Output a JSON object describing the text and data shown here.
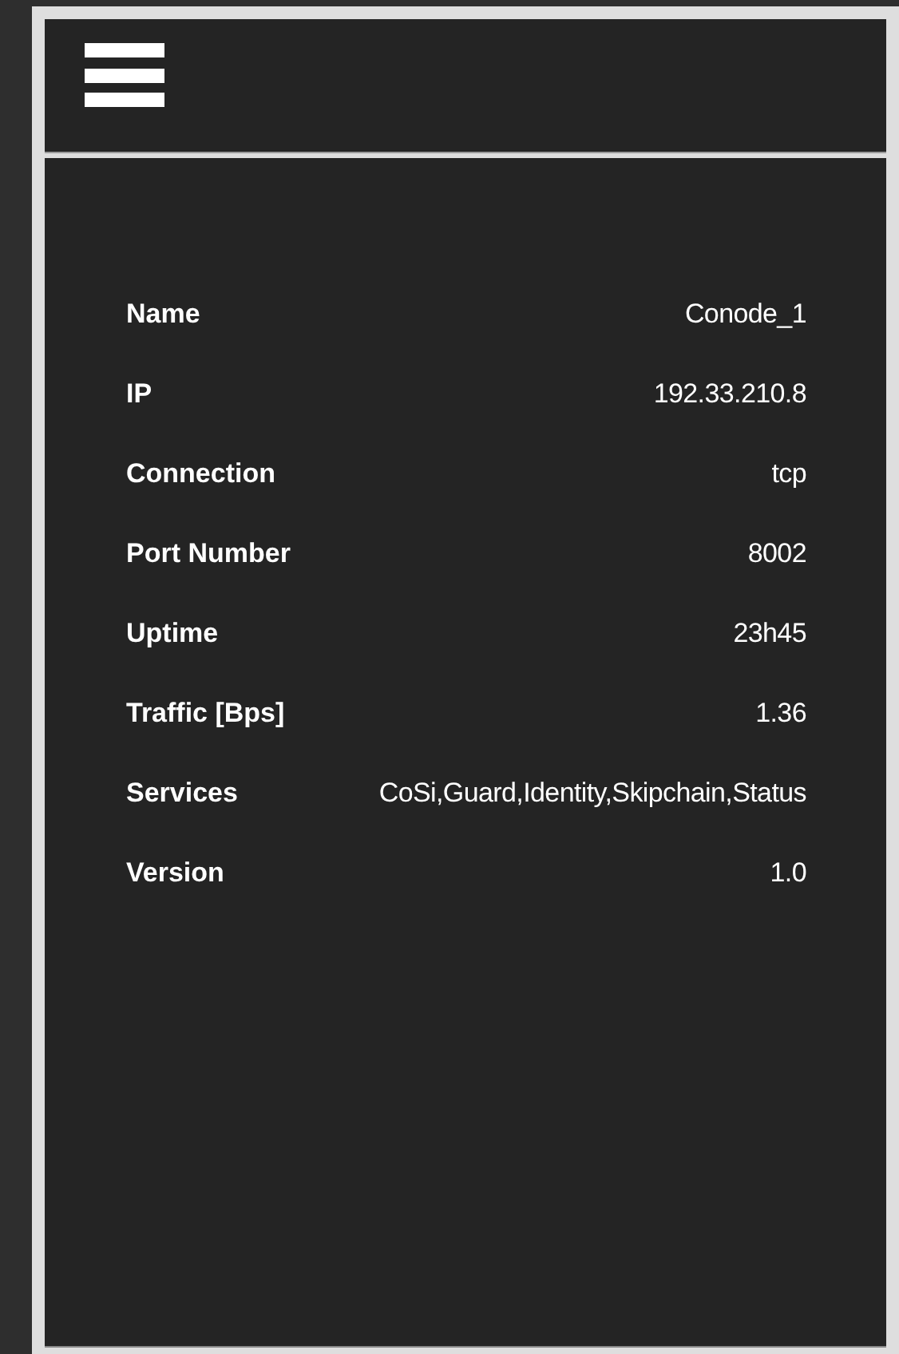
{
  "details": [
    {
      "label": "Name",
      "value": "Conode_1"
    },
    {
      "label": "IP",
      "value": "192.33.210.8"
    },
    {
      "label": "Connection",
      "value": "tcp"
    },
    {
      "label": "Port Number",
      "value": "8002"
    },
    {
      "label": "Uptime",
      "value": "23h45"
    },
    {
      "label": "Traffic [Bps]",
      "value": "1.36"
    },
    {
      "label": "Services",
      "value": "CoSi,Guard,Identity,Skipchain,Status"
    },
    {
      "label": "Version",
      "value": "1.0"
    }
  ]
}
